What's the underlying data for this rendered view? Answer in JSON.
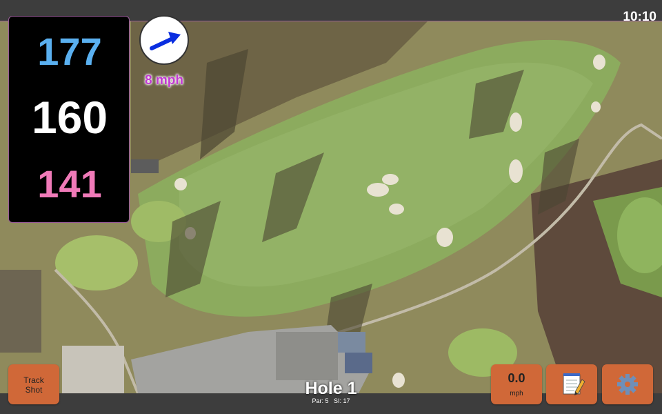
{
  "status_bar": {
    "clock": "10:10"
  },
  "distances": {
    "back": "177",
    "middle": "160",
    "front": "141"
  },
  "wind": {
    "speed_label": "8 mph",
    "icon": "arrow-icon"
  },
  "hole": {
    "title": "Hole 1",
    "par_label": "Par: 5",
    "si_label": "SI: 17"
  },
  "buttons": {
    "track_shot_line1": "Track",
    "track_shot_line2": "Shot",
    "wind_value": "0.0",
    "wind_unit": "mph",
    "notes_icon": "notepad-icon",
    "settings_icon": "gear-icon"
  },
  "colors": {
    "back_distance": "#5ab0f0",
    "middle_distance": "#ffffff",
    "front_distance": "#f07ab8",
    "wind_label": "#c23ad2",
    "button": "#d06838"
  }
}
